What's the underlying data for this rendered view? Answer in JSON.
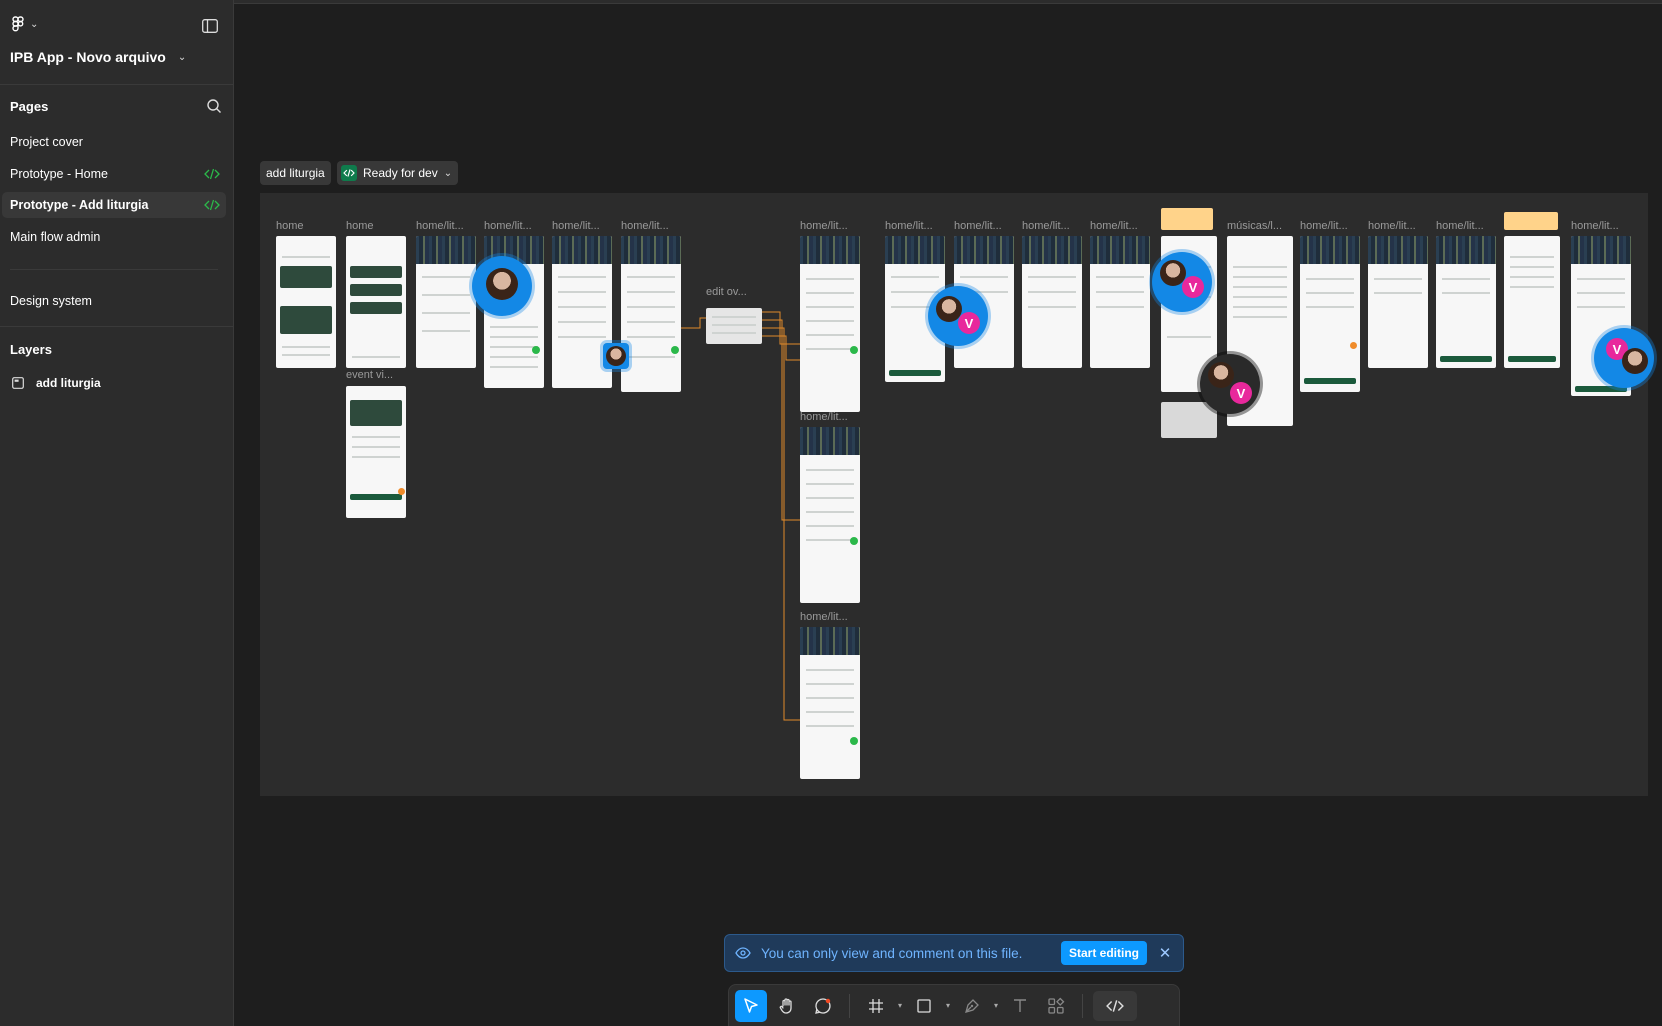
{
  "file": {
    "title": "IPB App - Novo arquivo"
  },
  "pages": {
    "title": "Pages",
    "items": [
      {
        "label": "Project cover"
      },
      {
        "label": "Prototype - Home"
      },
      {
        "label": "Prototype - Add liturgia"
      },
      {
        "label": "Main flow admin"
      },
      {
        "label": "Design system"
      }
    ]
  },
  "layers": {
    "title": "Layers",
    "items": [
      {
        "label": "add liturgia"
      }
    ]
  },
  "canvas": {
    "section_name": "add liturgia",
    "status": "Ready for dev",
    "frame_labels": [
      "home",
      "home",
      "home/lit...",
      "home/lit...",
      "home/lit...",
      "home/lit...",
      "event vi...",
      "edit ov...",
      "home/lit...",
      "home/lit...",
      "home/lit...",
      "home/lit...",
      "home/lit...",
      "home/lit...",
      "home/lit...",
      "músicas/l...",
      "home/lit...",
      "home/lit...",
      "home/lit...",
      "home/lit..."
    ],
    "collaborators": [
      {
        "initial": "V",
        "color": "#e8289c"
      },
      {
        "initial": "V",
        "color": "#e8289c"
      },
      {
        "initial": "V",
        "color": "#e8289c"
      },
      {
        "initial": "V",
        "color": "#e8289c"
      }
    ],
    "colors": {
      "accent": "#0d99ff",
      "frame_bg": "#f7f7f7",
      "brand_green": "#1b5a3c"
    }
  },
  "toast": {
    "message": "You can only view and comment on this file.",
    "action_label": "Start editing"
  },
  "toolbar": {
    "tools": [
      "move-tool",
      "hand-tool",
      "comment-tool",
      "frame-tool",
      "shape-tool",
      "pen-tool",
      "text-tool",
      "components-tool",
      "dev-mode-toggle"
    ],
    "active": "move-tool"
  }
}
